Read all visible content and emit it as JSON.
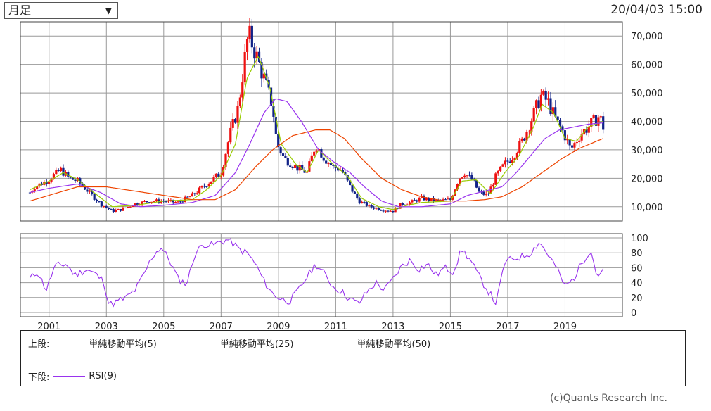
{
  "period_select": {
    "value": "月足"
  },
  "timestamp": "20/04/03 15:00",
  "copyright": "(c)Quants Research Inc.",
  "legend": {
    "upper_label": "上段:",
    "lower_label": "下段:",
    "upper_items": [
      {
        "label": "単純移動平均(5)",
        "color": "#99cc00"
      },
      {
        "label": "単純移動平均(25)",
        "color": "#9933ee"
      },
      {
        "label": "単純移動平均(50)",
        "color": "#ee4400"
      }
    ],
    "lower_items": [
      {
        "label": "RSI(9)",
        "color": "#9933ee"
      }
    ]
  },
  "chart_data": [
    {
      "type": "candlestick",
      "panel": "price",
      "ylim": [
        5000,
        75000
      ],
      "ytick_labels": [
        "10,000",
        "20,000",
        "30,000",
        "40,000",
        "50,000",
        "60,000",
        "70,000"
      ],
      "yticks": [
        10000,
        20000,
        30000,
        40000,
        50000,
        60000,
        70000
      ],
      "xtick_labels": [
        "2001",
        "2003",
        "2005",
        "2007",
        "2009",
        "2011",
        "2013",
        "2015",
        "2017",
        "2019"
      ],
      "xticks": [
        2001,
        2003,
        2005,
        2007,
        2009,
        2011,
        2013,
        2015,
        2017,
        2019
      ],
      "xlim": [
        2000.0,
        2021.0
      ],
      "up_color": "#ee1111",
      "down_color": "#112288",
      "series": [
        {
          "name": "close_path_knots",
          "x": [
            2000.33,
            2000.5,
            2000.9,
            2001.4,
            2001.7,
            2002.0,
            2002.4,
            2002.8,
            2003.2,
            2003.5,
            2004.0,
            2004.5,
            2005.0,
            2005.5,
            2006.0,
            2006.5,
            2007.0,
            2007.3,
            2007.6,
            2007.8,
            2007.95,
            2008.2,
            2008.5,
            2008.8,
            2008.95,
            2009.2,
            2009.6,
            2010.0,
            2010.3,
            2010.6,
            2010.9,
            2011.2,
            2011.5,
            2011.8,
            2012.2,
            2012.6,
            2013.0,
            2013.3,
            2013.6,
            2014.0,
            2014.5,
            2015.0,
            2015.3,
            2015.5,
            2015.8,
            2016.0,
            2016.3,
            2016.6,
            2016.9,
            2017.2,
            2017.5,
            2017.8,
            2018.0,
            2018.15,
            2018.4,
            2018.7,
            2018.95,
            2019.2,
            2019.5,
            2019.9,
            2020.2,
            2020.33
          ],
          "y": [
            15000,
            17000,
            19000,
            23000,
            20000,
            19000,
            15000,
            11000,
            8500,
            9000,
            11000,
            12000,
            12000,
            11500,
            14000,
            18000,
            22000,
            35000,
            45000,
            60000,
            71000,
            64000,
            55000,
            45000,
            32000,
            27000,
            24000,
            22000,
            32000,
            27000,
            24000,
            23000,
            17000,
            12000,
            10000,
            9000,
            8500,
            11000,
            11500,
            13000,
            12000,
            12500,
            20000,
            22000,
            19000,
            15000,
            14000,
            21000,
            25000,
            28000,
            33000,
            40000,
            45000,
            49000,
            47000,
            40000,
            36000,
            30000,
            35000,
            39000,
            42000,
            38000
          ]
        },
        {
          "name": "単純移動平均(5)",
          "x": [
            2000.33,
            2001.0,
            2001.5,
            2002.0,
            2002.5,
            2003.2,
            2004.0,
            2005.0,
            2006.0,
            2006.5,
            2007.0,
            2007.5,
            2007.9,
            2008.3,
            2008.7,
            2009.1,
            2009.6,
            2010.0,
            2010.4,
            2010.9,
            2011.4,
            2011.9,
            2012.5,
            2013.0,
            2013.5,
            2014.0,
            2015.0,
            2015.4,
            2015.9,
            2016.4,
            2016.9,
            2017.4,
            2017.9,
            2018.2,
            2018.6,
            2019.0,
            2019.4,
            2019.8,
            2020.33
          ],
          "y": [
            16000,
            19000,
            22000,
            19500,
            15500,
            10000,
            10500,
            12000,
            12500,
            16000,
            21000,
            32000,
            55000,
            63000,
            52000,
            32000,
            25000,
            22000,
            30000,
            25000,
            21000,
            13000,
            10000,
            9000,
            10500,
            11500,
            12000,
            19000,
            19500,
            14500,
            22000,
            28000,
            38000,
            46000,
            43000,
            34000,
            33000,
            38000,
            40000
          ]
        },
        {
          "name": "単純移動平均(25)",
          "x": [
            2000.33,
            2001.0,
            2002.0,
            2002.8,
            2003.5,
            2004.2,
            2005.0,
            2006.0,
            2006.8,
            2007.5,
            2008.0,
            2008.5,
            2008.9,
            2009.3,
            2009.8,
            2010.4,
            2010.9,
            2011.5,
            2012.0,
            2012.6,
            2013.2,
            2014.0,
            2015.0,
            2015.6,
            2016.2,
            2016.8,
            2017.3,
            2017.8,
            2018.3,
            2018.8,
            2019.3,
            2019.8,
            2020.33
          ],
          "y": [
            15000,
            16500,
            18000,
            15000,
            11000,
            10000,
            10500,
            11500,
            14000,
            22000,
            32000,
            43000,
            48000,
            47000,
            40000,
            30000,
            26000,
            22000,
            17000,
            12000,
            10000,
            10000,
            11000,
            14000,
            15500,
            17000,
            22000,
            28000,
            34000,
            37000,
            38000,
            39000,
            39500
          ]
        },
        {
          "name": "単純移動平均(50)",
          "x": [
            2000.33,
            2001.0,
            2002.0,
            2003.0,
            2004.0,
            2005.0,
            2006.0,
            2006.8,
            2007.5,
            2008.2,
            2008.8,
            2009.5,
            2010.3,
            2010.8,
            2011.3,
            2011.9,
            2012.6,
            2013.3,
            2014.0,
            2014.8,
            2015.5,
            2016.2,
            2016.8,
            2017.5,
            2018.2,
            2018.9,
            2019.5,
            2020.33
          ],
          "y": [
            12000,
            14000,
            17000,
            17000,
            15500,
            14000,
            12500,
            12500,
            16000,
            24000,
            30000,
            35000,
            37000,
            37000,
            34000,
            27000,
            20000,
            16000,
            13500,
            12000,
            12000,
            12500,
            13500,
            17000,
            22000,
            27000,
            30500,
            34000
          ]
        }
      ]
    },
    {
      "type": "line",
      "panel": "rsi",
      "ylim": [
        0,
        100
      ],
      "ytick_labels": [
        "0",
        "20",
        "40",
        "60",
        "80",
        "100"
      ],
      "yticks": [
        0,
        20,
        40,
        60,
        80,
        100
      ],
      "series": [
        {
          "name": "RSI(9)",
          "x": [
            2000.33,
            2000.6,
            2000.9,
            2001.2,
            2001.6,
            2001.9,
            2002.3,
            2002.6,
            2002.9,
            2003.1,
            2003.4,
            2003.7,
            2004.0,
            2004.3,
            2004.6,
            2004.9,
            2005.2,
            2005.5,
            2005.8,
            2006.1,
            2006.4,
            2006.7,
            2007.0,
            2007.3,
            2007.6,
            2007.9,
            2008.2,
            2008.5,
            2008.8,
            2009.1,
            2009.4,
            2009.7,
            2010.0,
            2010.3,
            2010.6,
            2010.9,
            2011.2,
            2011.5,
            2011.8,
            2012.1,
            2012.4,
            2012.7,
            2013.0,
            2013.3,
            2013.6,
            2013.9,
            2014.2,
            2014.5,
            2014.8,
            2015.1,
            2015.4,
            2015.7,
            2016.0,
            2016.3,
            2016.6,
            2016.9,
            2017.2,
            2017.5,
            2017.8,
            2018.1,
            2018.4,
            2018.7,
            2019.0,
            2019.3,
            2019.6,
            2019.9,
            2020.1,
            2020.33
          ],
          "y": [
            45,
            55,
            30,
            62,
            65,
            50,
            58,
            52,
            42,
            10,
            15,
            20,
            30,
            50,
            75,
            88,
            70,
            45,
            38,
            80,
            92,
            90,
            95,
            98,
            85,
            80,
            65,
            42,
            25,
            18,
            15,
            30,
            48,
            65,
            52,
            35,
            28,
            18,
            12,
            28,
            40,
            30,
            45,
            62,
            70,
            58,
            65,
            50,
            60,
            55,
            85,
            70,
            48,
            30,
            12,
            68,
            72,
            75,
            80,
            95,
            78,
            60,
            35,
            45,
            68,
            85,
            50,
            55
          ]
        }
      ]
    }
  ]
}
